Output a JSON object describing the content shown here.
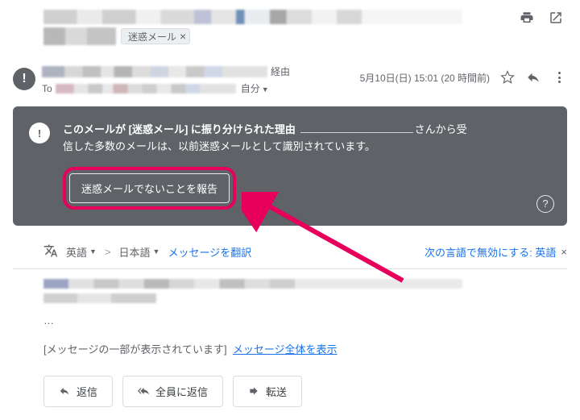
{
  "top": {
    "spam_chip": "迷惑メール"
  },
  "header": {
    "via": "経由",
    "to_label": "To",
    "self_label": "自分",
    "timestamp": "5月10日(日) 15:01 (20 時間前)"
  },
  "banner": {
    "reason_prefix": "このメールが",
    "reason_bold": "[迷惑メール]",
    "reason_mid": " に振り分けられた理由",
    "reason_suffix1": "さんから受",
    "reason_line2": "信した多数のメールは、以前迷惑メールとして識別されています。",
    "report_button": "迷惑メールでないことを報告"
  },
  "translate": {
    "from_lang": "英語",
    "to_lang": "日本語",
    "translate_link": "メッセージを翻訳",
    "disable_label": "次の言語で無効にする: ",
    "disable_lang": "英語"
  },
  "body": {
    "ellipsis": "…",
    "truncated_label": "[メッセージの一部が表示されています]",
    "show_full_link": "メッセージ全体を表示"
  },
  "actions": {
    "reply": "返信",
    "reply_all": "全員に返信",
    "forward": "転送"
  }
}
